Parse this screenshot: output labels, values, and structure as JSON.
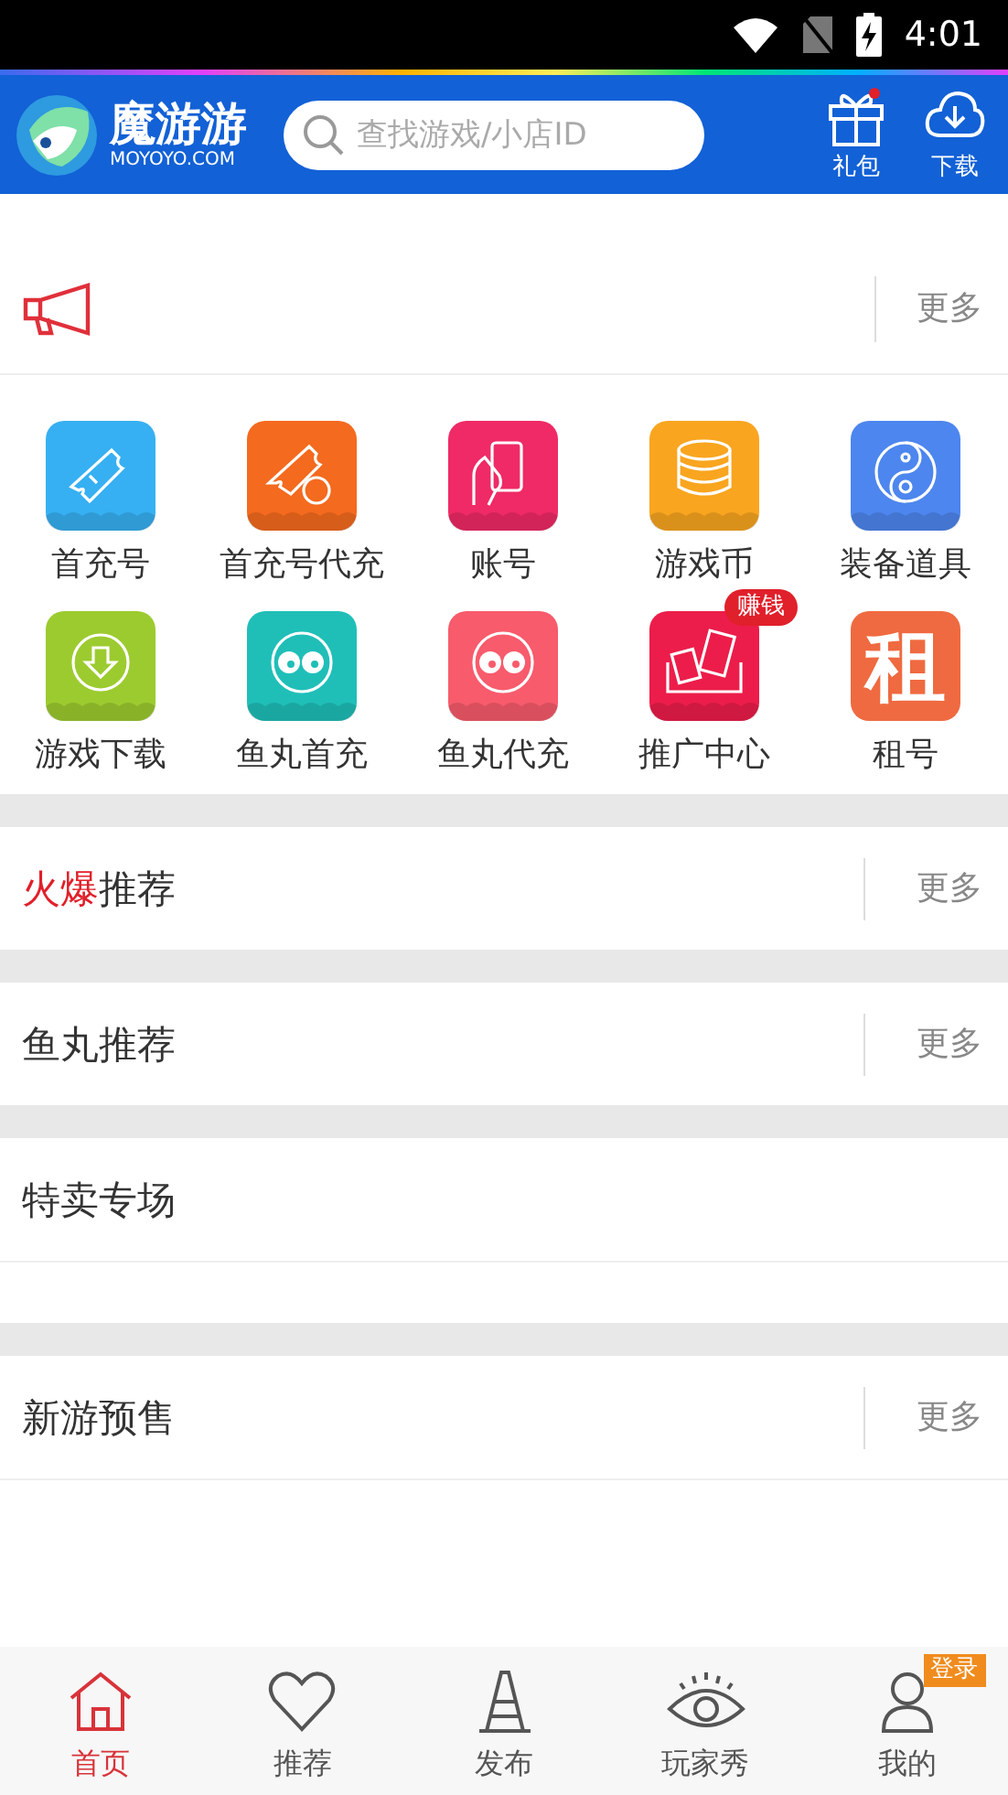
{
  "status_bar": {
    "time": "4:01"
  },
  "header": {
    "logo_title": "魔游游",
    "logo_subtitle": "MOYOYO.COM",
    "search": {
      "placeholder": "查找游戏/小店ID"
    },
    "actions": [
      {
        "kind": "gift",
        "label": "礼包",
        "dot": true
      },
      {
        "kind": "download",
        "label": "下载",
        "dot": false
      }
    ]
  },
  "notice": {
    "more": "更多"
  },
  "shortcuts": [
    {
      "kind": "ticket",
      "label": "首充号",
      "color": "#36b0f2"
    },
    {
      "kind": "ticket_dai",
      "label": "首充号代充",
      "color": "#f46a1e"
    },
    {
      "kind": "card",
      "label": "账号",
      "color": "#ef2a66"
    },
    {
      "kind": "coins",
      "label": "游戏币",
      "color": "#f9a51f"
    },
    {
      "kind": "yinyang",
      "label": "装备道具",
      "color": "#4d86ee"
    },
    {
      "kind": "download",
      "label": "游戏下载",
      "color": "#9ccb2f"
    },
    {
      "kind": "eyes",
      "label": "鱼丸首充",
      "color": "#1fbfb8"
    },
    {
      "kind": "eyes",
      "label": "鱼丸代充",
      "color": "#f85b6c"
    },
    {
      "kind": "envelope",
      "label": "推广中心",
      "color": "#ec1d4a",
      "badge": "赚钱"
    },
    {
      "kind": "glyph",
      "label": "租号",
      "color": "#ef6a40",
      "glyph": "租"
    }
  ],
  "sections": [
    {
      "kind": "plain",
      "accent": "火爆",
      "title": "推荐",
      "more": "更多"
    },
    {
      "kind": "plain",
      "title": "鱼丸推荐",
      "more": "更多"
    },
    {
      "kind": "with_body",
      "title": "特卖专场"
    },
    {
      "kind": "with_body",
      "title": "新游预售",
      "more": "更多"
    }
  ],
  "tab_bar": [
    {
      "kind": "home",
      "label": "首页",
      "selected": true
    },
    {
      "kind": "heart",
      "label": "推荐",
      "selected": false
    },
    {
      "kind": "cone",
      "label": "发布",
      "selected": false
    },
    {
      "kind": "eye",
      "label": "玩家秀",
      "selected": false
    },
    {
      "kind": "user",
      "label": "我的",
      "selected": false,
      "badge": "登录"
    }
  ]
}
